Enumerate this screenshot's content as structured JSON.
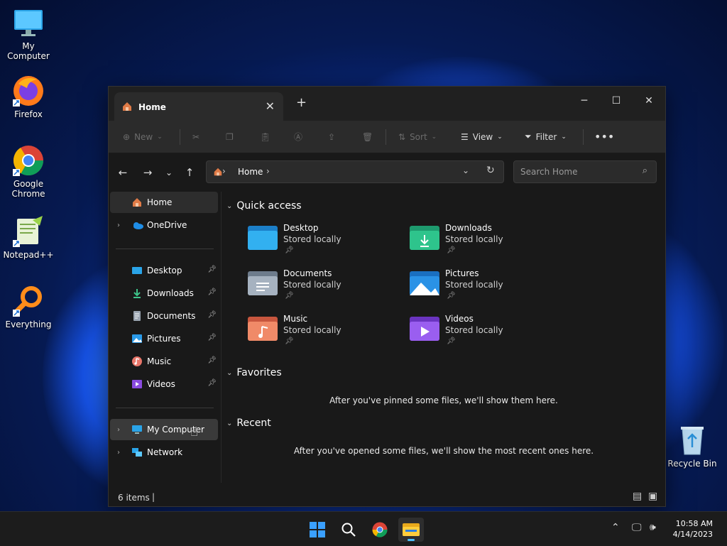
{
  "desktop": {
    "icons": [
      {
        "label": "My Computer"
      },
      {
        "label": "Firefox"
      },
      {
        "label": "Google Chrome"
      },
      {
        "label": "Notepad++"
      },
      {
        "label": "Everything"
      },
      {
        "label": "Recycle Bin"
      }
    ]
  },
  "window": {
    "tab_title": "Home",
    "toolbar": {
      "new_label": "New",
      "sort_label": "Sort",
      "view_label": "View",
      "filter_label": "Filter"
    },
    "address": {
      "location": "Home"
    },
    "search": {
      "placeholder": "Search Home"
    },
    "sidebar": {
      "top": [
        {
          "label": "Home"
        },
        {
          "label": "OneDrive"
        }
      ],
      "pinned": [
        {
          "label": "Desktop"
        },
        {
          "label": "Downloads"
        },
        {
          "label": "Documents"
        },
        {
          "label": "Pictures"
        },
        {
          "label": "Music"
        },
        {
          "label": "Videos"
        }
      ],
      "bottom": [
        {
          "label": "My Computer"
        },
        {
          "label": "Network"
        }
      ]
    },
    "main": {
      "quick_access_title": "Quick access",
      "quick_access": [
        {
          "name": "Desktop",
          "status": "Stored locally"
        },
        {
          "name": "Downloads",
          "status": "Stored locally"
        },
        {
          "name": "Documents",
          "status": "Stored locally"
        },
        {
          "name": "Pictures",
          "status": "Stored locally"
        },
        {
          "name": "Music",
          "status": "Stored locally"
        },
        {
          "name": "Videos",
          "status": "Stored locally"
        }
      ],
      "favorites_title": "Favorites",
      "favorites_empty": "After you've pinned some files, we'll show them here.",
      "recent_title": "Recent",
      "recent_empty": "After you've opened some files, we'll show the most recent ones here."
    },
    "status": {
      "item_count": "6 items"
    }
  },
  "taskbar": {
    "time": "10:58 AM",
    "date": "4/14/2023"
  },
  "colors": {
    "accent": "#4cc2ff",
    "window_bg": "#191919",
    "toolbar_bg": "#2b2b2b"
  }
}
